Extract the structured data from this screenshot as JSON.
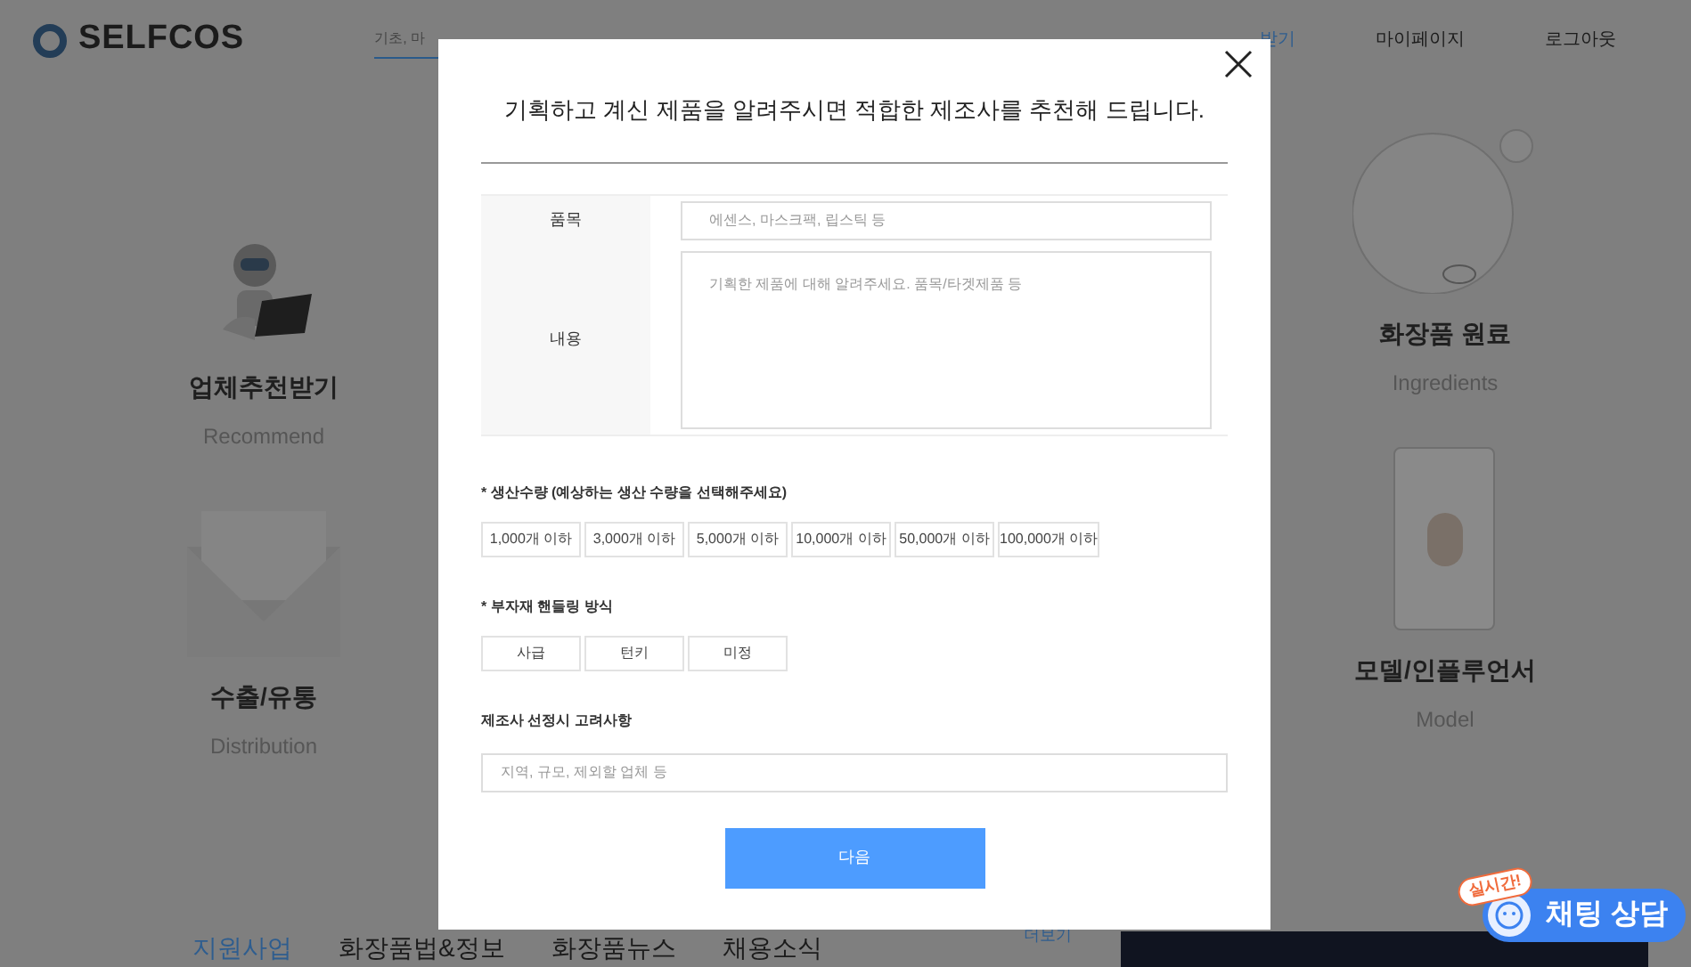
{
  "header": {
    "logo": "SELFCOS",
    "search": {
      "placeholder": "기초, 마"
    },
    "nav": [
      {
        "label": "받기",
        "selected": true
      },
      {
        "label": "마이페이지",
        "selected": false
      },
      {
        "label": "로그아웃",
        "selected": false
      }
    ]
  },
  "services_left": [
    {
      "kind": "robot",
      "title": "업체추천받기",
      "subtitle": "Recommend"
    },
    {
      "kind": "envelope",
      "title": "수출/유통",
      "subtitle": "Distribution"
    }
  ],
  "services_right": [
    {
      "kind": "bubble",
      "title": "화장품 원료",
      "subtitle": "Ingredients"
    },
    {
      "kind": "phone",
      "title": "모델/인플루언서",
      "subtitle": "Model"
    }
  ],
  "bottom_tabs": [
    {
      "label": "지원사업",
      "selected": true
    },
    {
      "label": "화장품법&정보",
      "selected": false
    },
    {
      "label": "화장품뉴스",
      "selected": false
    },
    {
      "label": "채용소식",
      "selected": false
    }
  ],
  "more_link": "더보기",
  "chat": {
    "badge": "실시간!",
    "label": "채팅 상담"
  },
  "modal": {
    "title": "기획하고 계신 제품을 알려주시면 적합한 제조사를 추천해 드립니다.",
    "rows": [
      {
        "kind": "input",
        "label": "품목",
        "placeholder": "에센스, 마스크팩, 립스틱 등"
      },
      {
        "kind": "textarea",
        "label": "내용",
        "placeholder": "기획한 제품에 대해 알려주세요. 품목/타겟제품 등"
      }
    ],
    "quantity": {
      "label": "* 생산수량 (예상하는 생산 수량을 선택해주세요)",
      "options": [
        {
          "label": "1,000개 이하",
          "selected": false
        },
        {
          "label": "3,000개 이하",
          "selected": false
        },
        {
          "label": "5,000개 이하",
          "selected": false
        },
        {
          "label": "10,000개 이하",
          "selected": false
        },
        {
          "label": "50,000개 이하",
          "selected": false
        },
        {
          "label": "100,000개 이하",
          "selected": false
        }
      ]
    },
    "handling": {
      "label": "* 부자재 핸들링 방식",
      "options": [
        {
          "label": "사급",
          "selected": false
        },
        {
          "label": "턴키",
          "selected": false
        },
        {
          "label": "미정",
          "selected": false
        }
      ]
    },
    "considerations": {
      "label": "제조사 선정시 고려사항",
      "placeholder": "지역, 규모, 제외할 업체 등"
    },
    "next_button": "다음"
  }
}
